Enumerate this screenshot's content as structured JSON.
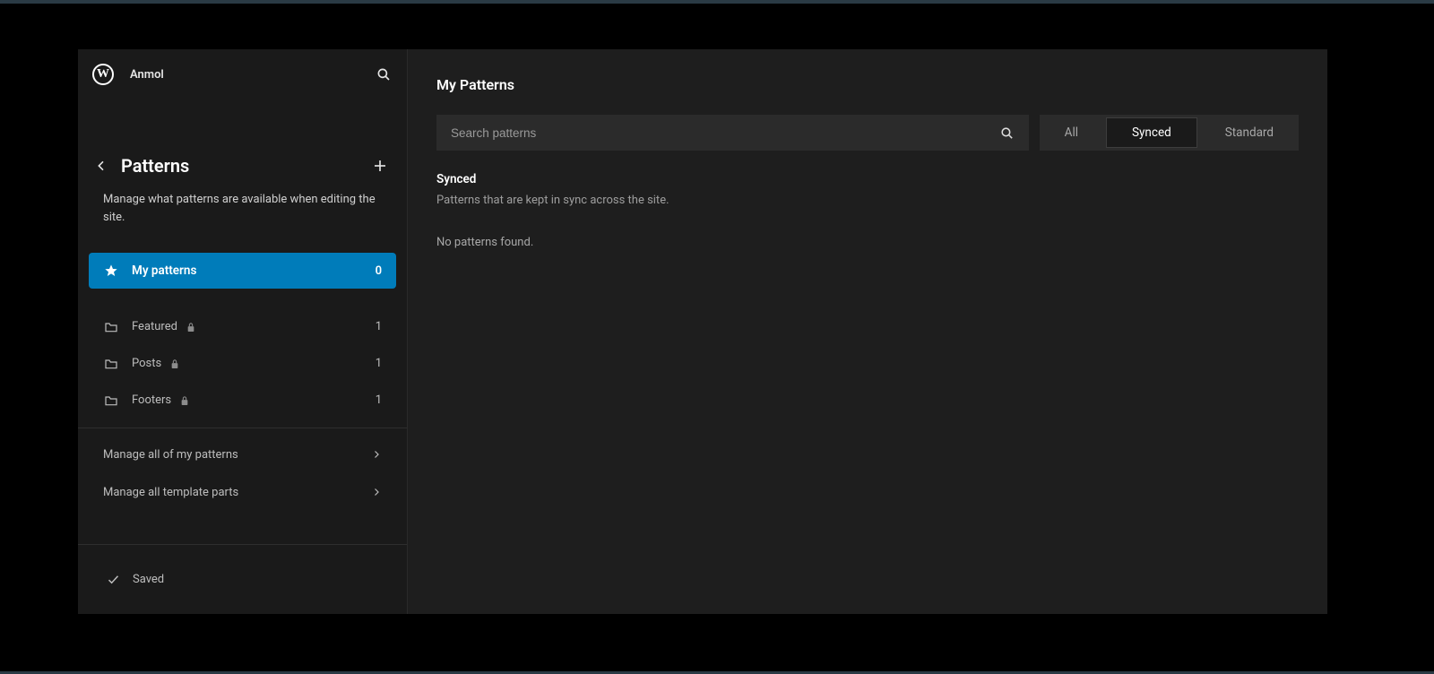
{
  "site": {
    "name": "Anmol"
  },
  "sidebar": {
    "title": "Patterns",
    "description": "Manage what patterns are available when editing the site.",
    "active": {
      "label": "My patterns",
      "count": "0"
    },
    "folders": [
      {
        "label": "Featured",
        "count": "1",
        "locked": true
      },
      {
        "label": "Posts",
        "count": "1",
        "locked": true
      },
      {
        "label": "Footers",
        "count": "1",
        "locked": true
      }
    ],
    "manage": [
      {
        "label": "Manage all of my patterns"
      },
      {
        "label": "Manage all template parts"
      }
    ],
    "saved_label": "Saved"
  },
  "main": {
    "title": "My Patterns",
    "search_placeholder": "Search patterns",
    "filters": {
      "all": "All",
      "synced": "Synced",
      "standard": "Standard"
    },
    "section": {
      "heading": "Synced",
      "description": "Patterns that are kept in sync across the site.",
      "empty": "No patterns found."
    }
  }
}
